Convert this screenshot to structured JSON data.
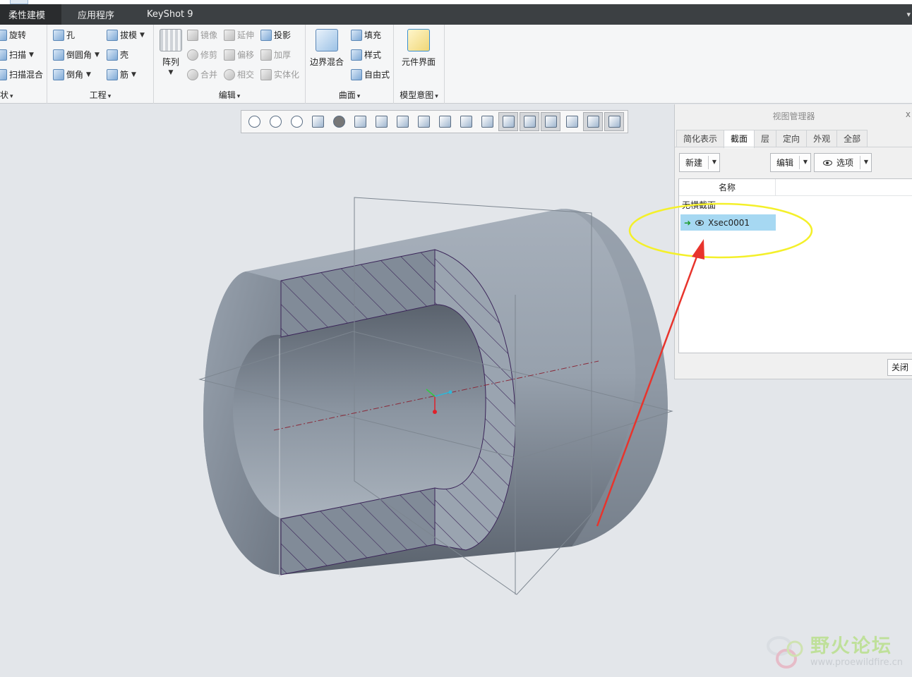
{
  "menu": {
    "tabs": [
      "柔性建模",
      "应用程序",
      "KeyShot 9"
    ]
  },
  "ribbon": {
    "shape_group": {
      "label": "状",
      "buttons": [
        "旋转",
        "扫描",
        "扫描混合"
      ]
    },
    "engineering_group": {
      "label": "工程",
      "buttons": [
        "孔",
        "拔模",
        "倒圆角",
        "壳",
        "倒角",
        "筋"
      ]
    },
    "editing_group": {
      "label": "编辑",
      "pattern_label": "阵列",
      "buttons": [
        "镜像",
        "延伸",
        "投影",
        "修剪",
        "偏移",
        "加厚",
        "合并",
        "相交",
        "实体化"
      ]
    },
    "surface_group": {
      "label": "曲面",
      "boundary_blend": "边界混合",
      "buttons": [
        "填充",
        "样式",
        "自由式"
      ]
    },
    "model_intent_group": {
      "label": "模型意图",
      "component_interface": "元件界面"
    }
  },
  "view_manager": {
    "title": "视图管理器",
    "close_x": "x",
    "tabs": [
      "简化表示",
      "截面",
      "层",
      "定向",
      "外观",
      "全部"
    ],
    "active_tab": "截面",
    "new_button": "新建",
    "edit_button": "编辑",
    "options_button": "选项",
    "column_name": "名称",
    "rows": [
      "无横截面",
      "Xsec0001"
    ],
    "active_row": "Xsec0001",
    "close_button": "关闭"
  },
  "watermark": {
    "title": "野火论坛",
    "url": "www.proewildfire.cn"
  },
  "colors": {
    "menubar": "#3c4043",
    "model_light": "#9aa4b0",
    "model_dark": "#5c6470",
    "hatch": "#4a2a6a",
    "highlight_ellipse": "#f4f02a",
    "arrow": "#e8342c",
    "selected_row": "#a6d8f2"
  }
}
